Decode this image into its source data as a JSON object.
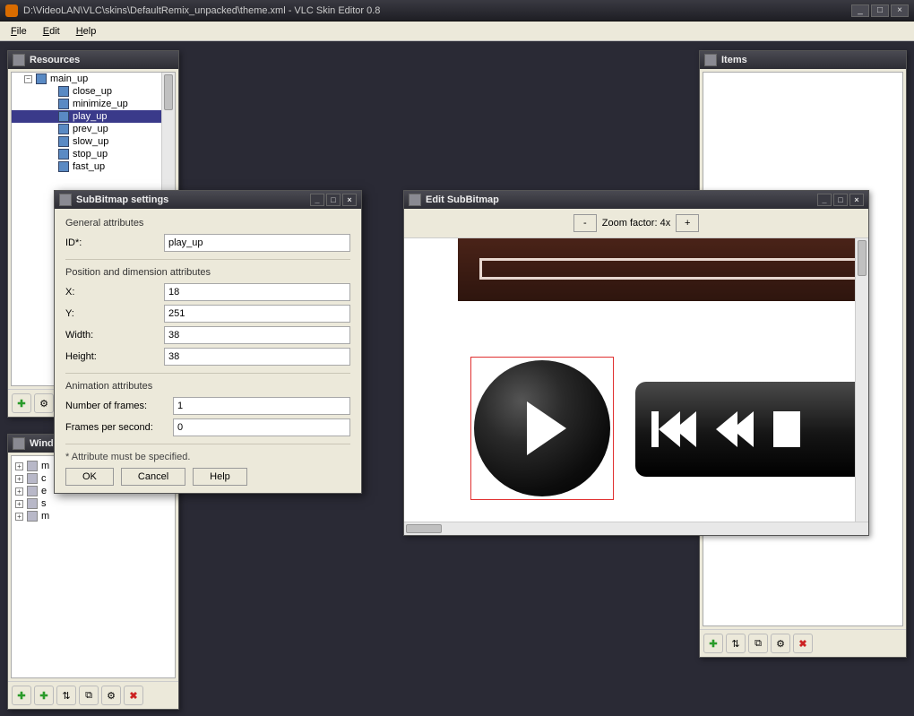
{
  "window": {
    "title": "D:\\VideoLAN\\VLC\\skins\\DefaultRemix_unpacked\\theme.xml - VLC Skin Editor 0.8"
  },
  "menu": {
    "file": "File",
    "edit": "Edit",
    "help": "Help"
  },
  "panels": {
    "resources": {
      "title": "Resources",
      "items": [
        {
          "label": "main_up",
          "expandable": true
        },
        {
          "label": "close_up"
        },
        {
          "label": "minimize_up"
        },
        {
          "label": "play_up",
          "selected": true
        },
        {
          "label": "prev_up"
        },
        {
          "label": "slow_up"
        },
        {
          "label": "stop_up"
        },
        {
          "label": "fast_up"
        }
      ]
    },
    "items": {
      "title": "Items"
    },
    "windows": {
      "title": "Windows",
      "rows": [
        {
          "label": "m"
        },
        {
          "label": "c"
        },
        {
          "label": "e"
        },
        {
          "label": "s"
        },
        {
          "label": "m"
        }
      ]
    }
  },
  "dialog": {
    "title": "SubBitmap settings",
    "general_head": "General attributes",
    "id_label": "ID*:",
    "id_value": "play_up",
    "posdim_head": "Position and dimension attributes",
    "x_label": "X:",
    "x_value": "18",
    "y_label": "Y:",
    "y_value": "251",
    "w_label": "Width:",
    "w_value": "38",
    "h_label": "Height:",
    "h_value": "38",
    "anim_head": "Animation attributes",
    "nframes_label": "Number of frames:",
    "nframes_value": "1",
    "fps_label": "Frames per second:",
    "fps_value": "0",
    "note": "* Attribute must be specified.",
    "ok": "OK",
    "cancel": "Cancel",
    "help": "Help"
  },
  "subwin": {
    "title": "Edit SubBitmap",
    "zoom_minus": "-",
    "zoom_label": "Zoom factor: 4x",
    "zoom_plus": "+"
  },
  "toolbar_glyphs": {
    "plus": "✚",
    "clone": "⧉",
    "dup": "◱",
    "opts": "⚙",
    "del": "✖",
    "updown": "⇅"
  }
}
